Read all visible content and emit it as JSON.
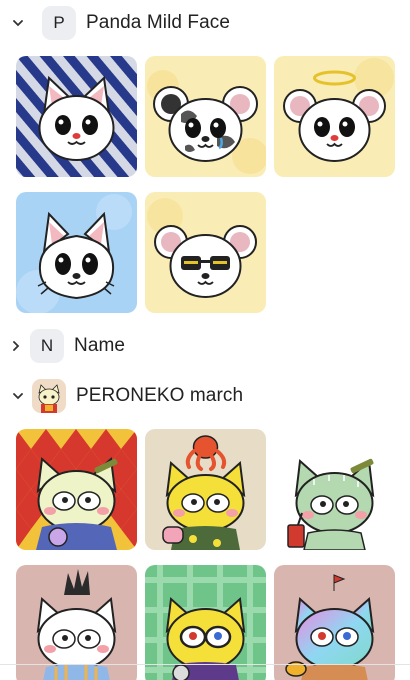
{
  "collections": [
    {
      "initial": "P",
      "name": "Panda Mild Face",
      "expanded": true,
      "items": [
        {
          "icon": "white-cat-panda-icon",
          "bg": "#2c3f8a"
        },
        {
          "icon": "cow-mouse-panda-icon",
          "bg": "#f8e9a8"
        },
        {
          "icon": "angel-mouse-panda-icon",
          "bg": "#f8e9a8"
        },
        {
          "icon": "white-cat-sky-icon",
          "bg": "#a9d2f4"
        },
        {
          "icon": "sunglasses-mouse-icon",
          "bg": "#f8e9a8"
        }
      ]
    },
    {
      "initial": "N",
      "name": "Name",
      "expanded": false,
      "items": []
    },
    {
      "initial": "",
      "name": "PERONEKO march",
      "expanded": true,
      "items": [
        {
          "icon": "cat-harlequin-icon",
          "bg": "#d33a2f"
        },
        {
          "icon": "cat-octopus-icon",
          "bg": "#e7dcc7"
        },
        {
          "icon": "cat-cactus-icon",
          "bg": "#ffffff"
        },
        {
          "icon": "cat-mohawk-icon",
          "bg": "#d9b5b0"
        },
        {
          "icon": "cat-glasses-icon",
          "bg": "#6fc48a"
        },
        {
          "icon": "cat-rainbow-icon",
          "bg": "#d9b5b0"
        }
      ]
    }
  ]
}
